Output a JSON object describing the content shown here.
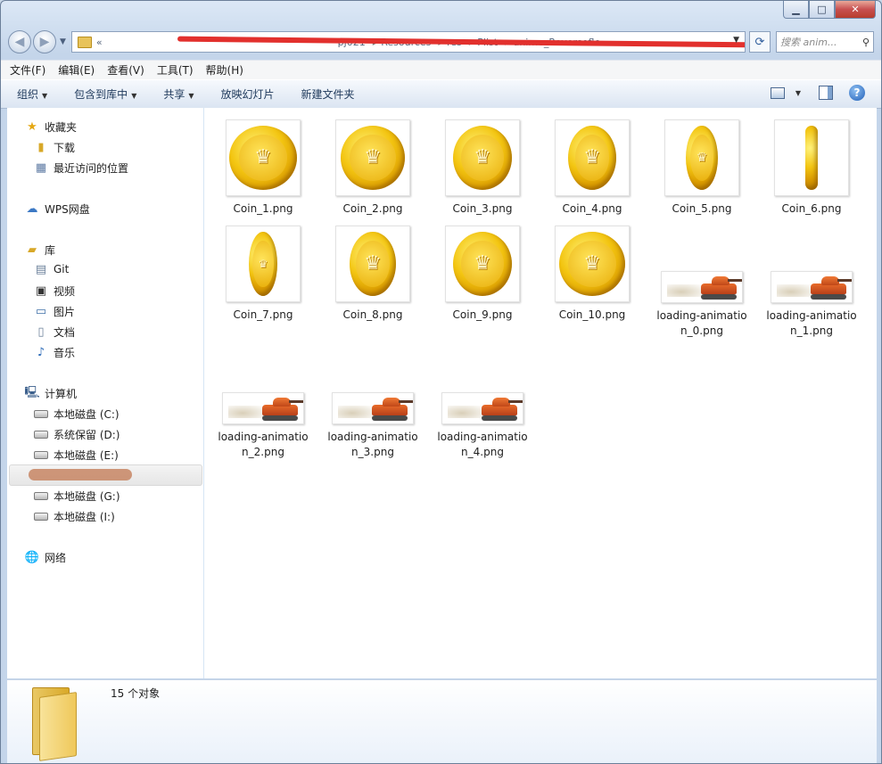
{
  "window": {
    "buttons": {
      "minimize": "▁",
      "maximize": "□",
      "close": "✕"
    }
  },
  "address": {
    "crumbs": [
      "«",
      "pj021",
      "Resources",
      "res",
      "Plist",
      "anime_Reversefle"
    ],
    "search_placeholder": "搜索 anim..."
  },
  "menu": [
    "文件(F)",
    "编辑(E)",
    "查看(V)",
    "工具(T)",
    "帮助(H)"
  ],
  "toolbar": {
    "organize": "组织",
    "include_library": "包含到库中",
    "share": "共享",
    "slideshow": "放映幻灯片",
    "new_folder": "新建文件夹"
  },
  "sidebar": {
    "favorites": "收藏夹",
    "downloads": "下载",
    "recent": "最近访问的位置",
    "wps": "WPS网盘",
    "libraries": "库",
    "git": "Git",
    "video": "视频",
    "pictures": "图片",
    "docs": "文档",
    "music": "音乐",
    "computer": "计算机",
    "drive_c": "本地磁盘 (C:)",
    "drive_d": "系统保留 (D:)",
    "drive_e": "本地磁盘 (E:)",
    "drive_g": "本地磁盘 (G:)",
    "drive_i": "本地磁盘 (I:)",
    "network": "网络"
  },
  "files": [
    {
      "name": "Coin_1.png"
    },
    {
      "name": "Coin_2.png"
    },
    {
      "name": "Coin_3.png"
    },
    {
      "name": "Coin_4.png"
    },
    {
      "name": "Coin_5.png"
    },
    {
      "name": "Coin_6.png"
    },
    {
      "name": "Coin_7.png"
    },
    {
      "name": "Coin_8.png"
    },
    {
      "name": "Coin_9.png"
    },
    {
      "name": "Coin_10.png"
    },
    {
      "name": "loading-animation_0.png"
    },
    {
      "name": "loading-animation_1.png"
    },
    {
      "name": "loading-animation_2.png"
    },
    {
      "name": "loading-animation_3.png"
    },
    {
      "name": "loading-animation_4.png"
    }
  ],
  "status": {
    "count": "15 个对象"
  }
}
